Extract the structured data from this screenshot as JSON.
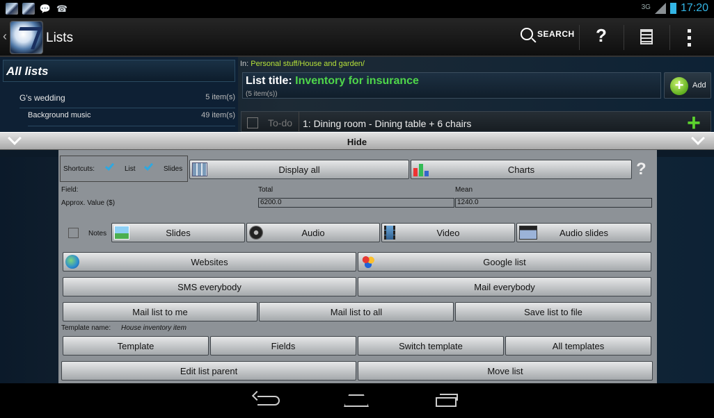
{
  "status": {
    "network": "3G",
    "time": "17:20"
  },
  "actionbar": {
    "title": "Lists",
    "search_label": "SEARCH",
    "help_label": "?"
  },
  "sidebar": {
    "header": "All lists",
    "items": [
      {
        "label": "G's wedding",
        "count": "5 item(s)"
      },
      {
        "label": "Background music",
        "count": "49 item(s)"
      }
    ]
  },
  "detail": {
    "in_label": "In:",
    "path": "Personal stuff/House and garden/",
    "title_label": "List title:",
    "title_value": "Inventory for insurance",
    "item_count": "(5 item(s))",
    "add_label": "Add",
    "todo_label": "To-do",
    "first_item": "1: Dining room -  Dining table + 6 chairs"
  },
  "hidebar": {
    "label": "Hide"
  },
  "panel": {
    "shortcuts_label": "Shortcuts:",
    "shortcut_list": "List",
    "shortcut_slides": "Slides",
    "display_all": "Display all",
    "charts": "Charts",
    "help": "?",
    "field_label": "Field:",
    "total_label": "Total",
    "mean_label": "Mean",
    "field_name": "Approx. Value ($)",
    "total_value": "6200.0",
    "mean_value": "1240.0",
    "notes_label": "Notes",
    "slides": "Slides",
    "audio": "Audio",
    "video": "Video",
    "audio_slides": "Audio slides",
    "websites": "Websites",
    "google_list": "Google list",
    "sms_everybody": "SMS everybody",
    "mail_everybody": "Mail everybody",
    "mail_list_to_me": "Mail list to me",
    "mail_list_to_all": "Mail list to all",
    "save_list_to_file": "Save list to file",
    "template_name_label": "Template name:",
    "template_name": "House inventory item",
    "template": "Template",
    "fields": "Fields",
    "switch_template": "Switch template",
    "all_templates": "All templates",
    "edit_list_parent": "Edit list parent",
    "move_list": "Move list"
  },
  "colors": {
    "accent": "#33b5e5",
    "path": "#b7e33a",
    "title": "#4fd64a"
  }
}
